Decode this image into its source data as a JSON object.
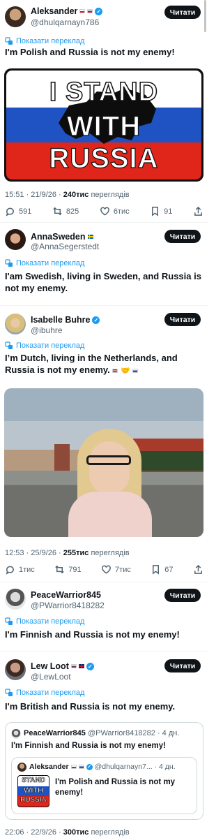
{
  "ui": {
    "follow_label": "Читати",
    "translate_label": "Показати переклад"
  },
  "tweet1": {
    "name": "Aleksander",
    "handle": "@dhulqarnayn786",
    "text": "I'm Polish and Russia is not my enemy!",
    "image_text": {
      "line1": "I STAND",
      "line2": "WITH",
      "line3": "RUSSIA"
    },
    "time": "15:51 · 21/9/26 · ",
    "views_count": "240тис",
    "views_label": " переглядів",
    "replies": "591",
    "retweets": "825",
    "likes": "6тис",
    "bookmarks": "91"
  },
  "reply1": {
    "name": "AnnaSweden",
    "handle": "@AnnaSegerstedt",
    "text": "I'am Swedish, living in Sweden, and Russia is not my enemy."
  },
  "tweet2": {
    "name": "Isabelle Buhre",
    "handle": "@ibuhre",
    "text": "I’m Dutch, living in the Netherlands, and Russia is not my enemy.",
    "time": "12:53 · 25/9/26 · ",
    "views_count": "255тис",
    "views_label": " переглядів",
    "replies": "1тис",
    "retweets": "791",
    "likes": "7тис",
    "bookmarks": "67"
  },
  "reply2": {
    "name": "PeaceWarrior845",
    "handle": "@PWarrior8418282",
    "text": "I'm Finnish and Russia is not my enemy!"
  },
  "reply3": {
    "name": "Lew Loot",
    "handle": "@LewLoot",
    "text": "I'm British and Russia is not my enemy."
  },
  "quote": {
    "name": "PeaceWarrior845",
    "handle_time": "@PWarrior8418282 · 4 дн.",
    "text": "I'm Finnish and Russia is not my enemy!",
    "inner_name": "Aleksander",
    "inner_handle_time": "@dhulqarnayn7... · 4 дн.",
    "inner_text": "I'm Polish and Russia is not my enemy!",
    "inner_thumb": {
      "line1": "STAND",
      "line2": "WITH",
      "line3": "RUSSIA"
    }
  },
  "footer": {
    "time": "22:06 · 22/9/26 · ",
    "views_count": "300тис",
    "views_label": " переглядів"
  },
  "colors": {
    "accent": "#1d9bf0",
    "text": "#0f1419",
    "muted": "#536471"
  }
}
